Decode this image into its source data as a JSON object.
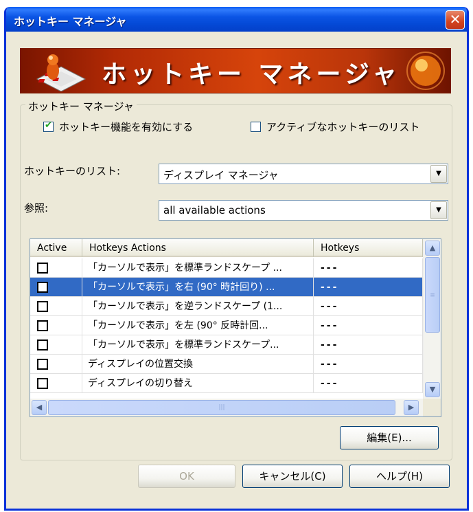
{
  "window": {
    "title": "ホットキー マネージャ",
    "close_label": "✕"
  },
  "banner": {
    "title": "ホットキー マネージャ"
  },
  "group": {
    "label": "ホットキー マネージャ"
  },
  "options": {
    "enable_label": "ホットキー機能を有効にする",
    "enable_checked": true,
    "active_list_label": "アクティブなホットキーのリスト",
    "active_list_checked": false
  },
  "hotkey_list": {
    "label": "ホットキーのリスト:",
    "value": "ディスプレイ マネージャ"
  },
  "reference": {
    "label": "参照:",
    "value": "all available actions"
  },
  "table": {
    "columns": [
      "Active",
      "Hotkeys Actions",
      "Hotkeys"
    ],
    "rows": [
      {
        "action": "「カーソルで表示」を標準ランドスケープ ...",
        "hotkey": "---",
        "selected": false
      },
      {
        "action": "「カーソルで表示」を右 (90° 時計回り) ...",
        "hotkey": "---",
        "selected": true
      },
      {
        "action": "「カーソルで表示」を逆ランドスケープ (1...",
        "hotkey": "---",
        "selected": false
      },
      {
        "action": "「カーソルで表示」を左 (90° 反時計回...",
        "hotkey": "---",
        "selected": false
      },
      {
        "action": "「カーソルで表示」を標準ランドスケープ...",
        "hotkey": "---",
        "selected": false
      },
      {
        "action": "ディスプレイの位置交換",
        "hotkey": "---",
        "selected": false
      },
      {
        "action": "ディスプレイの切り替え",
        "hotkey": "---",
        "selected": false
      }
    ]
  },
  "buttons": {
    "edit": "編集(E)...",
    "ok": "OK",
    "cancel": "キャンセル(C)",
    "help": "ヘルプ(H)"
  },
  "icons": {
    "close": "close-icon",
    "dropdown": "chevron-down-icon",
    "scroll_up": "arrow-up-icon",
    "scroll_down": "arrow-down-icon",
    "scroll_left": "arrow-left-icon",
    "scroll_right": "arrow-right-icon"
  },
  "colors": {
    "titlebar": "#0449d6",
    "selection": "#316ac5",
    "banner": "#d6440b",
    "window_bg": "#ece9d8"
  }
}
